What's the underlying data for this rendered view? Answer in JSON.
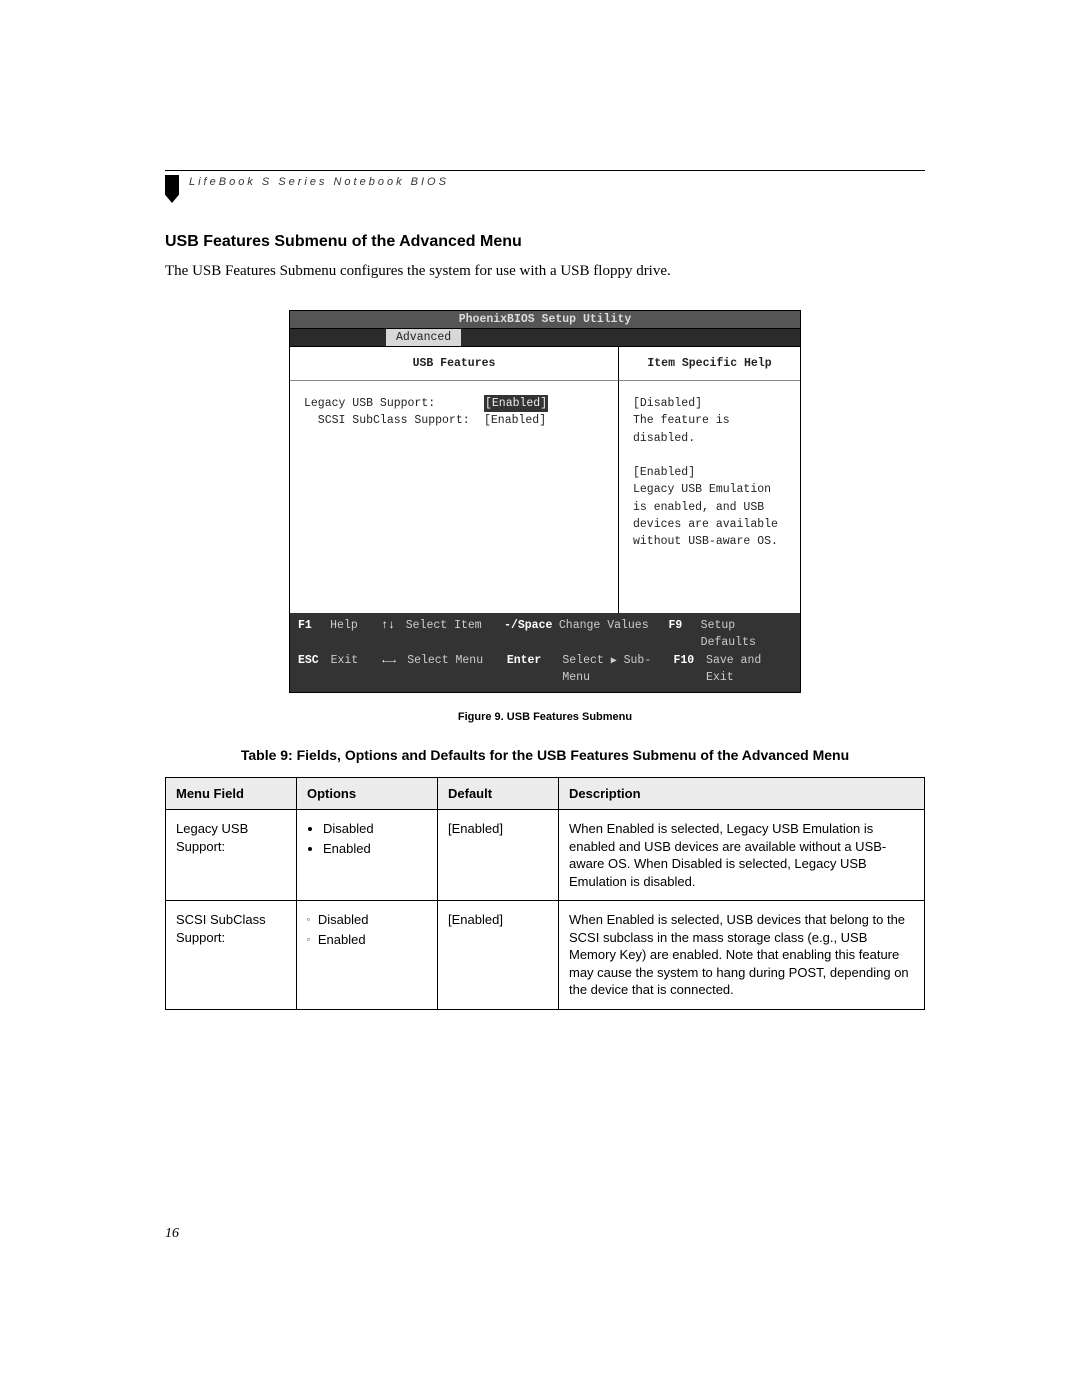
{
  "header": {
    "running_head": "LifeBook S Series Notebook BIOS"
  },
  "section": {
    "title": "USB Features Submenu of the Advanced Menu",
    "intro": "The USB Features Submenu configures the system for use with a USB floppy drive."
  },
  "bios": {
    "title": "PhoenixBIOS Setup Utility",
    "active_tab": "Advanced",
    "left_title": "USB Features",
    "right_title": "Item Specific Help",
    "fields": [
      {
        "label": "Legacy USB Support:",
        "value": "[Enabled]",
        "selected": true
      },
      {
        "label": "  SCSI SubClass Support:",
        "value": "[Enabled]",
        "selected": false
      }
    ],
    "help": "[Disabled]\nThe feature is disabled.\n\n[Enabled]\nLegacy USB Emulation\nis enabled, and USB\ndevices are available\nwithout USB-aware OS.",
    "footer": {
      "row1": {
        "k1": "F1",
        "l1": "Help",
        "a1": "↑↓",
        "act1": "Select Item",
        "k2": "-/Space",
        "act2": "Change Values",
        "k3": "F9",
        "act3": "Setup Defaults"
      },
      "row2": {
        "k1": "ESC",
        "l1": "Exit",
        "a1": "←→",
        "act1": "Select Menu",
        "k2": "Enter",
        "act2_pre": "Select ",
        "act2_post": " Sub-Menu",
        "k3": "F10",
        "act3": "Save and Exit"
      }
    }
  },
  "figure_caption": "Figure 9.  USB Features Submenu",
  "table_caption": "Table 9: Fields, Options and Defaults for the USB Features Submenu of the Advanced Menu",
  "table": {
    "headers": {
      "field": "Menu Field",
      "options": "Options",
      "default": "Default",
      "desc": "Description"
    },
    "rows": [
      {
        "field": "Legacy USB Support:",
        "options": [
          "Disabled",
          "Enabled"
        ],
        "bullet_style": "disc",
        "default": "[Enabled]",
        "desc": "When Enabled is selected, Legacy USB Emulation is enabled and USB devices are available without a USB-aware OS. When Disabled is selected, Legacy USB Emulation is disabled."
      },
      {
        "field": "SCSI SubClass Support:",
        "options": [
          "Disabled",
          "Enabled"
        ],
        "bullet_style": "square",
        "default": "[Enabled]",
        "desc": "When Enabled is selected, USB devices that belong to the SCSI subclass in the mass storage class (e.g., USB Memory Key) are enabled. Note that enabling this feature may cause the system to hang during POST, depending on the device that is connected."
      }
    ]
  },
  "page_number": "16"
}
